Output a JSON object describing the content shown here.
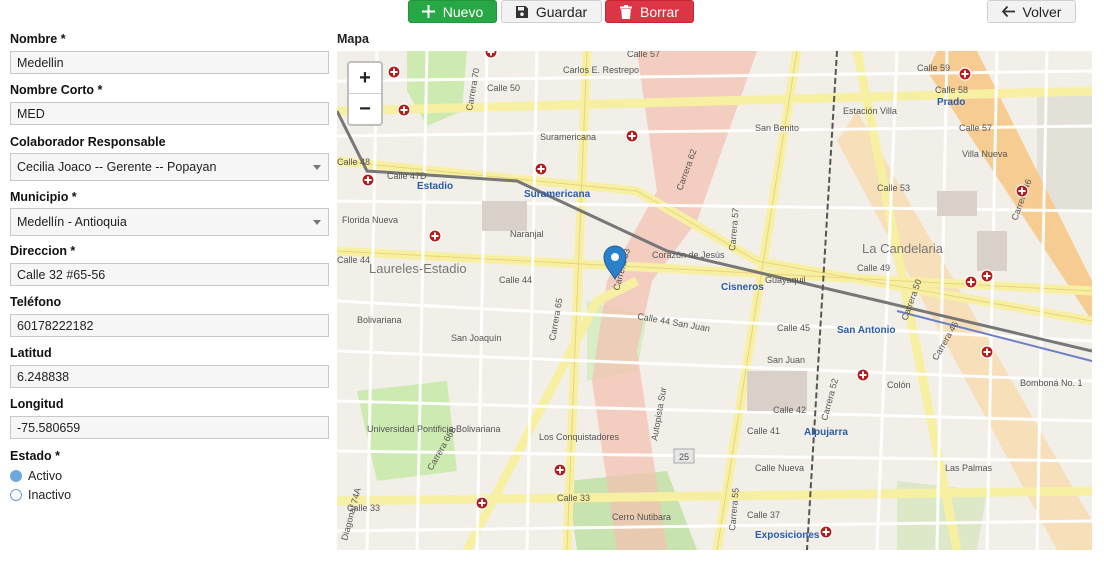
{
  "toolbar": {
    "nuevo_label": "Nuevo",
    "guardar_label": "Guardar",
    "borrar_label": "Borrar",
    "volver_label": "Volver"
  },
  "form": {
    "nombre_label": "Nombre *",
    "nombre_value": "Medellin",
    "nombre_corto_label": "Nombre Corto *",
    "nombre_corto_value": "MED",
    "colaborador_label": "Colaborador Responsable",
    "colaborador_value": "Cecilia Joaco -- Gerente -- Popayan",
    "municipio_label": "Municipio *",
    "municipio_value": "Medellín - Antioquia",
    "direccion_label": "Direccion *",
    "direccion_value": "Calle 32 #65-56",
    "telefono_label": "Teléfono",
    "telefono_value": "60178222182",
    "latitud_label": "Latitud",
    "latitud_value": "6.248838",
    "longitud_label": "Longitud",
    "longitud_value": "-75.580659",
    "estado_label": "Estado *",
    "estado_options": [
      "Activo",
      "Inactivo"
    ],
    "estado_selected": "Activo"
  },
  "map": {
    "label": "Mapa",
    "zoom_in": "+",
    "zoom_out": "−",
    "place_labels": {
      "laureles": "Laureles-Estadio",
      "candelaria": "La Candelaria",
      "carlos_restrepo": "Carlos E. Restrepo",
      "suramericana": "Suramericana",
      "naranjal": "Naranjal",
      "florida_nueva": "Florida Nueva",
      "bolivariana": "Bolivariana",
      "san_joaquin": "San Joaquín",
      "los_conquistadores": "Los Conquistadores",
      "cerro_nutibara": "Cerro Nutibara",
      "corazon_jesus": "Corazón de Jesús",
      "san_benito": "San Benito",
      "estacion_villa": "Estación Villa",
      "villa_nueva": "Villa Nueva",
      "colon": "Colón",
      "bombona": "Bomboná No. 1",
      "las_palmas": "Las Palmas",
      "calle_nueva": "Calle Nueva",
      "guayaquil": "Guayaquil",
      "upb": "Universidad Pontificia Bolivariana"
    },
    "station_labels": {
      "estadio": "Estadio",
      "suramericana": "Suramericana",
      "cisneros": "Cisneros",
      "san_antonio": "San Antonio",
      "alpujarra": "Alpujarra",
      "exposiciones": "Exposiciones",
      "prado": "Prado"
    },
    "street_labels": {
      "calle44": "Calle 44",
      "calle44b": "Calle 44",
      "calle48": "Calle 48",
      "calle47d": "Calle 47D",
      "calle50": "Calle 50",
      "calle33": "Calle 33",
      "calle33b": "Calle 33",
      "carrera63": "Carrera 63",
      "carrera65": "Carrera 65",
      "carrera66b": "Carrera 66B",
      "carrera62": "Carrera 62",
      "carrera57": "Carrera 57",
      "carrera55": "Carrera 55",
      "carrera46": "Carrera 46",
      "carrera46b": "Carrera 46",
      "calle44sanjuan": "Calle 44 San Juan",
      "sanjuan": "San Juan",
      "autopista_sur": "Autopista Sur",
      "calle57": "Calle 57",
      "calle58": "Calle 58",
      "calle59": "Calle 59",
      "calle53": "Calle 53",
      "calle49": "Calle 49",
      "calle45": "Calle 45",
      "calle37": "Calle 37",
      "calle41": "Calle 41",
      "calle42": "Calle 42",
      "calle57top": "Calle 57",
      "carrera70": "Carrera 70",
      "diagonal74a": "Diagonal 74A",
      "carrera52": "Carrera 52",
      "carrera50": "Carrera 50"
    },
    "route_badge": "25"
  }
}
